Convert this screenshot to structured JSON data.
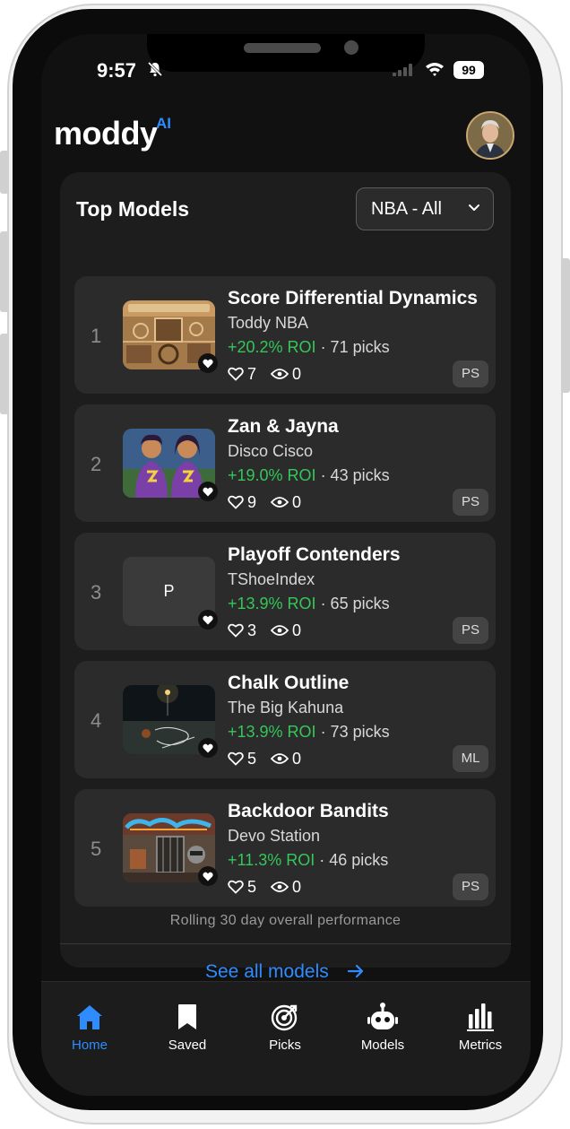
{
  "status_bar": {
    "time": "9:57",
    "battery": "99"
  },
  "header": {
    "logo_text": "moddy",
    "logo_superscript": "AI"
  },
  "top_models": {
    "title": "Top Models",
    "filter": {
      "selected": "NBA - All"
    },
    "models": [
      {
        "rank": "1",
        "name": "Score Differential Dynamics",
        "author": "Toddy NBA",
        "roi": "+20.2% ROI",
        "picks": " · 71 picks",
        "likes": "7",
        "views": "0",
        "type": "PS",
        "thumb_icon": "mechanical-board-image"
      },
      {
        "rank": "2",
        "name": "Zan & Jayna",
        "author": "Disco Cisco",
        "roi": "+19.0% ROI",
        "picks": " · 43 picks",
        "likes": "9",
        "views": "0",
        "type": "PS",
        "thumb_icon": "superhero-twins-image"
      },
      {
        "rank": "3",
        "name": "Playoff Contenders",
        "author": "TShoeIndex",
        "roi": "+13.9% ROI",
        "picks": " · 65 picks",
        "likes": "3",
        "views": "0",
        "type": "PS",
        "thumb_letter": "P"
      },
      {
        "rank": "4",
        "name": "Chalk Outline",
        "author": "The Big Kahuna",
        "roi": "+13.9% ROI",
        "picks": " · 73 picks",
        "likes": "5",
        "views": "0",
        "type": "ML",
        "thumb_icon": "dark-court-image"
      },
      {
        "rank": "5",
        "name": "Backdoor Bandits",
        "author": "Devo Station",
        "roi": "+11.3% ROI",
        "picks": " · 46 picks",
        "likes": "5",
        "views": "0",
        "type": "PS",
        "thumb_icon": "graffiti-raccoon-image"
      }
    ],
    "footnote": "Rolling 30 day overall performance",
    "see_all": "See all models"
  },
  "tab_bar": {
    "items": [
      {
        "label": "Home",
        "icon": "home-icon",
        "active": true
      },
      {
        "label": "Saved",
        "icon": "bookmark-icon",
        "active": false
      },
      {
        "label": "Picks",
        "icon": "target-icon",
        "active": false
      },
      {
        "label": "Models",
        "icon": "robot-icon",
        "active": false
      },
      {
        "label": "Metrics",
        "icon": "bar-chart-icon",
        "active": false
      }
    ]
  },
  "colors": {
    "accent": "#2f8cff",
    "positive": "#34c759",
    "background": "#111111",
    "card": "#2b2b2b"
  }
}
